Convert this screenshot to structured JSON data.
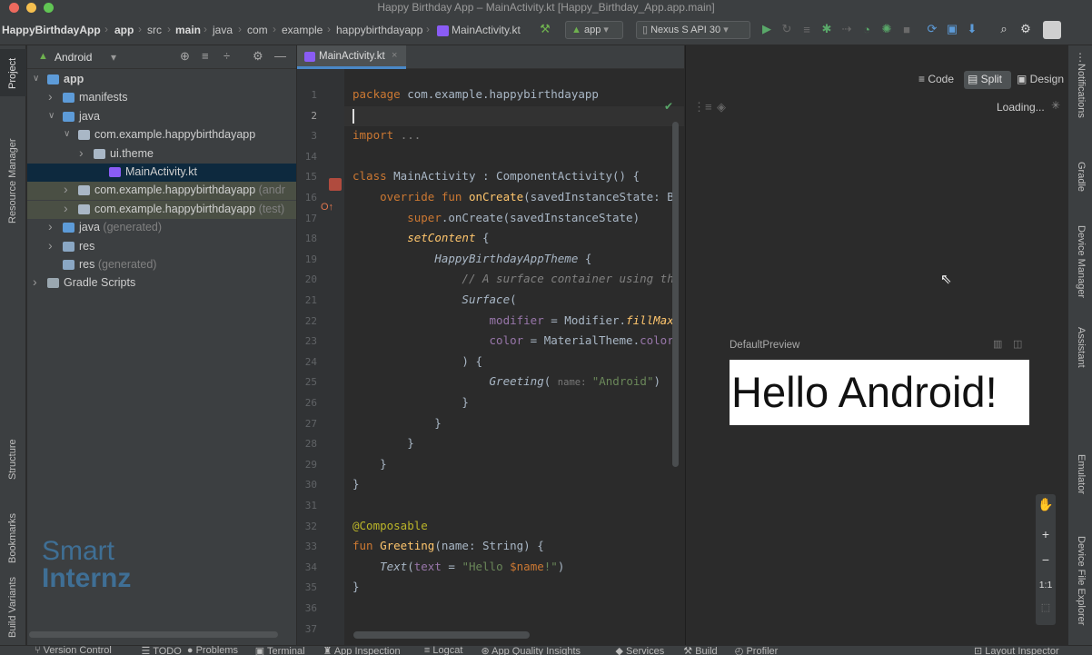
{
  "window": {
    "title": "Happy Birthday App – MainActivity.kt [Happy_Birthday_App.app.main]"
  },
  "breadcrumbs": [
    {
      "label": "HappyBirthdayApp",
      "bold": true
    },
    {
      "label": "app",
      "bold": true
    },
    {
      "label": "src",
      "bold": false
    },
    {
      "label": "main",
      "bold": true
    },
    {
      "label": "java",
      "bold": false
    },
    {
      "label": "com",
      "bold": false
    },
    {
      "label": "example",
      "bold": false
    },
    {
      "label": "happybirthdayapp",
      "bold": false
    },
    {
      "label": "MainActivity.kt",
      "bold": false
    }
  ],
  "toolbar": {
    "run_config": "app",
    "device": "Nexus S API 30"
  },
  "project": {
    "view_label": "Android",
    "tree": [
      {
        "label": "app",
        "suffix": "",
        "depth": 0,
        "arrow": "down",
        "icon": "folder-app",
        "bold": true
      },
      {
        "label": "manifests",
        "suffix": "",
        "depth": 1,
        "arrow": "right",
        "icon": "folder"
      },
      {
        "label": "java",
        "suffix": "",
        "depth": 1,
        "arrow": "down",
        "icon": "folder"
      },
      {
        "label": "com.example.happybirthdayapp",
        "suffix": "",
        "depth": 2,
        "arrow": "down",
        "icon": "package"
      },
      {
        "label": "ui.theme",
        "suffix": "",
        "depth": 3,
        "arrow": "right",
        "icon": "package"
      },
      {
        "label": "MainActivity.kt",
        "suffix": "",
        "depth": 4,
        "arrow": "",
        "icon": "kotlin",
        "selected": true
      },
      {
        "label": "com.example.happybirthdayapp",
        "suffix": "(andr",
        "depth": 2,
        "arrow": "right",
        "icon": "package",
        "highlight": true
      },
      {
        "label": "com.example.happybirthdayapp",
        "suffix": "(test)",
        "depth": 2,
        "arrow": "right",
        "icon": "package",
        "highlight": true
      },
      {
        "label": "java",
        "suffix": "(generated)",
        "depth": 1,
        "arrow": "right",
        "icon": "folder-gen"
      },
      {
        "label": "res",
        "suffix": "",
        "depth": 1,
        "arrow": "right",
        "icon": "res"
      },
      {
        "label": "res",
        "suffix": "(generated)",
        "depth": 1,
        "arrow": "",
        "icon": "res"
      },
      {
        "label": "Gradle Scripts",
        "suffix": "",
        "depth": 0,
        "arrow": "right",
        "icon": "gradle"
      }
    ]
  },
  "watermark": {
    "line1": "Smart",
    "line2": "Internz"
  },
  "editor": {
    "tab_label": "MainActivity.kt",
    "line_numbers": [
      "1",
      "2",
      "3",
      "14",
      "15",
      "16",
      "17",
      "18",
      "19",
      "20",
      "21",
      "22",
      "23",
      "24",
      "25",
      "26",
      "27",
      "28",
      "29",
      "30",
      "31",
      "32",
      "33",
      "34",
      "35",
      "36",
      "37"
    ],
    "code": [
      [
        {
          "t": "package ",
          "c": "kw"
        },
        {
          "t": "com.example.happybirthdayapp",
          "c": ""
        }
      ],
      [
        {
          "t": "",
          "c": ""
        }
      ],
      [
        {
          "t": "import ",
          "c": "kw"
        },
        {
          "t": "...",
          "c": "gr"
        }
      ],
      [
        {
          "t": "",
          "c": ""
        }
      ],
      [
        {
          "t": "class ",
          "c": "kw"
        },
        {
          "t": "MainActivity : ComponentActivity() {",
          "c": ""
        }
      ],
      [
        {
          "t": "    override fun ",
          "c": "kw"
        },
        {
          "t": "onCreate",
          "c": "fn"
        },
        {
          "t": "(savedInstanceState: B",
          "c": ""
        }
      ],
      [
        {
          "t": "        ",
          "c": ""
        },
        {
          "t": "super",
          "c": "kw"
        },
        {
          "t": ".onCreate(savedInstanceState)",
          "c": ""
        }
      ],
      [
        {
          "t": "        ",
          "c": ""
        },
        {
          "t": "setContent",
          "c": "fn it"
        },
        {
          "t": " {",
          "c": ""
        }
      ],
      [
        {
          "t": "            ",
          "c": ""
        },
        {
          "t": "HappyBirthdayAppTheme",
          "c": "it"
        },
        {
          "t": " {",
          "c": ""
        }
      ],
      [
        {
          "t": "                ",
          "c": ""
        },
        {
          "t": "// A surface container using th",
          "c": "cm"
        }
      ],
      [
        {
          "t": "                ",
          "c": ""
        },
        {
          "t": "Surface",
          "c": "it"
        },
        {
          "t": "(",
          "c": ""
        }
      ],
      [
        {
          "t": "                    ",
          "c": ""
        },
        {
          "t": "modifier",
          "c": "pu"
        },
        {
          "t": " = Modifier.",
          "c": ""
        },
        {
          "t": "fillMax",
          "c": "fn it"
        }
      ],
      [
        {
          "t": "                    ",
          "c": ""
        },
        {
          "t": "color",
          "c": "pu"
        },
        {
          "t": " = MaterialTheme.",
          "c": ""
        },
        {
          "t": "color",
          "c": "pu"
        }
      ],
      [
        {
          "t": "                ) {",
          "c": ""
        }
      ],
      [
        {
          "t": "                    ",
          "c": ""
        },
        {
          "t": "Greeting",
          "c": "it"
        },
        {
          "t": "( ",
          "c": ""
        },
        {
          "t": "name: ",
          "c": "hint"
        },
        {
          "t": "\"Android\"",
          "c": "str"
        },
        {
          "t": ")",
          "c": ""
        }
      ],
      [
        {
          "t": "                }",
          "c": ""
        }
      ],
      [
        {
          "t": "            }",
          "c": ""
        }
      ],
      [
        {
          "t": "        }",
          "c": ""
        }
      ],
      [
        {
          "t": "    }",
          "c": ""
        }
      ],
      [
        {
          "t": "}",
          "c": ""
        }
      ],
      [
        {
          "t": "",
          "c": ""
        }
      ],
      [
        {
          "t": "@Composable",
          "c": "an"
        }
      ],
      [
        {
          "t": "fun ",
          "c": "kw"
        },
        {
          "t": "Greeting",
          "c": "fn"
        },
        {
          "t": "(name: String) {",
          "c": ""
        }
      ],
      [
        {
          "t": "    ",
          "c": ""
        },
        {
          "t": "Text",
          "c": "it"
        },
        {
          "t": "(",
          "c": ""
        },
        {
          "t": "text",
          "c": "pu"
        },
        {
          "t": " = ",
          "c": ""
        },
        {
          "t": "\"Hello ",
          "c": "str"
        },
        {
          "t": "$name",
          "c": "kw"
        },
        {
          "t": "!\"",
          "c": "str"
        },
        {
          "t": ")",
          "c": ""
        }
      ],
      [
        {
          "t": "}",
          "c": ""
        }
      ],
      [
        {
          "t": "",
          "c": ""
        }
      ],
      [
        {
          "t": "",
          "c": ""
        }
      ]
    ]
  },
  "preview": {
    "mode_code": "Code",
    "mode_split": "Split",
    "mode_design": "Design",
    "loading": "Loading...",
    "label": "DefaultPreview",
    "text": "Hello Android!",
    "zoom_reset": "1:1"
  },
  "left_tabs": {
    "project": "Project",
    "resource_manager": "Resource Manager",
    "structure": "Structure",
    "bookmarks": "Bookmarks",
    "build_variants": "Build Variants"
  },
  "right_tabs": {
    "notifications": "Notifications",
    "gradle": "Gradle",
    "device_manager": "Device Manager",
    "assistant": "Assistant",
    "emulator": "Emulator",
    "device_file_explorer": "Device File Explorer"
  },
  "bottom_tabs": [
    {
      "label": "Version Control",
      "icon": "branch-icon"
    },
    {
      "label": "TODO",
      "icon": "list-icon"
    },
    {
      "label": "Problems",
      "icon": "problems-icon"
    },
    {
      "label": "Terminal",
      "icon": "terminal-icon"
    },
    {
      "label": "App Inspection",
      "icon": "inspection-icon"
    },
    {
      "label": "Logcat",
      "icon": "logcat-icon"
    },
    {
      "label": "App Quality Insights",
      "icon": "quality-icon"
    },
    {
      "label": "Services",
      "icon": "services-icon"
    },
    {
      "label": "Build",
      "icon": "hammer-icon"
    },
    {
      "label": "Profiler",
      "icon": "profiler-icon"
    }
  ],
  "bottom_right_tab": "Layout Inspector",
  "colors": {
    "selection": "#0d293e",
    "highlight": "#4a4f44",
    "kotlin_purple": "#8a5cf5",
    "folder_blue": "#5d9bd8",
    "watermark": "#3f6f95"
  }
}
